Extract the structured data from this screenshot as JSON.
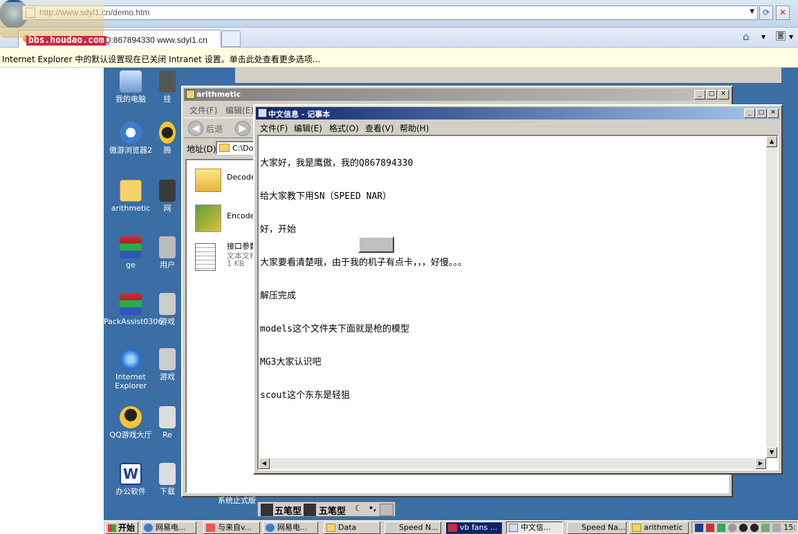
{
  "browser": {
    "url": "http://www.sdyl1.cn/demo.htm",
    "tab_title": "csol改NAR加密包QQ:867894330 www.sdyl1.cn",
    "watermark_text": "bbs.houdao.com",
    "infobar_text": "Internet Explorer 中的默认设置现在已关闭 Intranet 设置。单击此处查看更多选项..."
  },
  "desktop": {
    "icons_col1": [
      "我的电脑",
      "傲游浏览器2",
      "arithmetic",
      "ge",
      "PackAssist0306",
      "Internet Explorer",
      "QQ游戏大厅",
      "办公软件"
    ],
    "icons_col2": [
      "挂",
      "腾",
      "网",
      "用户",
      "游戏",
      "游戏",
      "Re",
      "下载"
    ]
  },
  "explorer": {
    "title": "arithmetic",
    "menus": [
      "文件(F)",
      "编辑(E)"
    ],
    "back_label": "后退",
    "address_label": "地址(D)",
    "address_value": "C:\\Doc",
    "files": [
      {
        "name": "Decode_",
        "type": "folder"
      },
      {
        "name": "Encode_",
        "type": "exe"
      },
      {
        "name": "接口参数",
        "sub1": "文本文档",
        "sub2": "1 KB",
        "type": "txt"
      }
    ],
    "status_text": "系统止式版"
  },
  "notepad": {
    "title": "中文信息 - 记事本",
    "menus": [
      "文件(F)",
      "编辑(E)",
      "格式(O)",
      "查看(V)",
      "帮助(H)"
    ],
    "lines": [
      "大家好，我是鹰傲，我的Q867894330",
      "给大家教下用SN（SPEED NAR）",
      "好，开始",
      "大家要看清楚哦，由于我的机子有点卡，，，好慢。。。",
      "解压完成",
      "models这个文件夹下面就是枪的模型",
      "MG3大家认识吧",
      "scout这个东东是轻狙"
    ]
  },
  "ime": {
    "label1": "五笔型",
    "label2": "五笔型"
  },
  "taskbar": {
    "start_label": "开始",
    "buttons": [
      "网易电...",
      "与来自v...",
      "网易电...",
      "Data",
      "Speed N...",
      "vb fans ...",
      "中文信...",
      "Speed Na...",
      "arithmetic"
    ],
    "clock": "15:"
  }
}
